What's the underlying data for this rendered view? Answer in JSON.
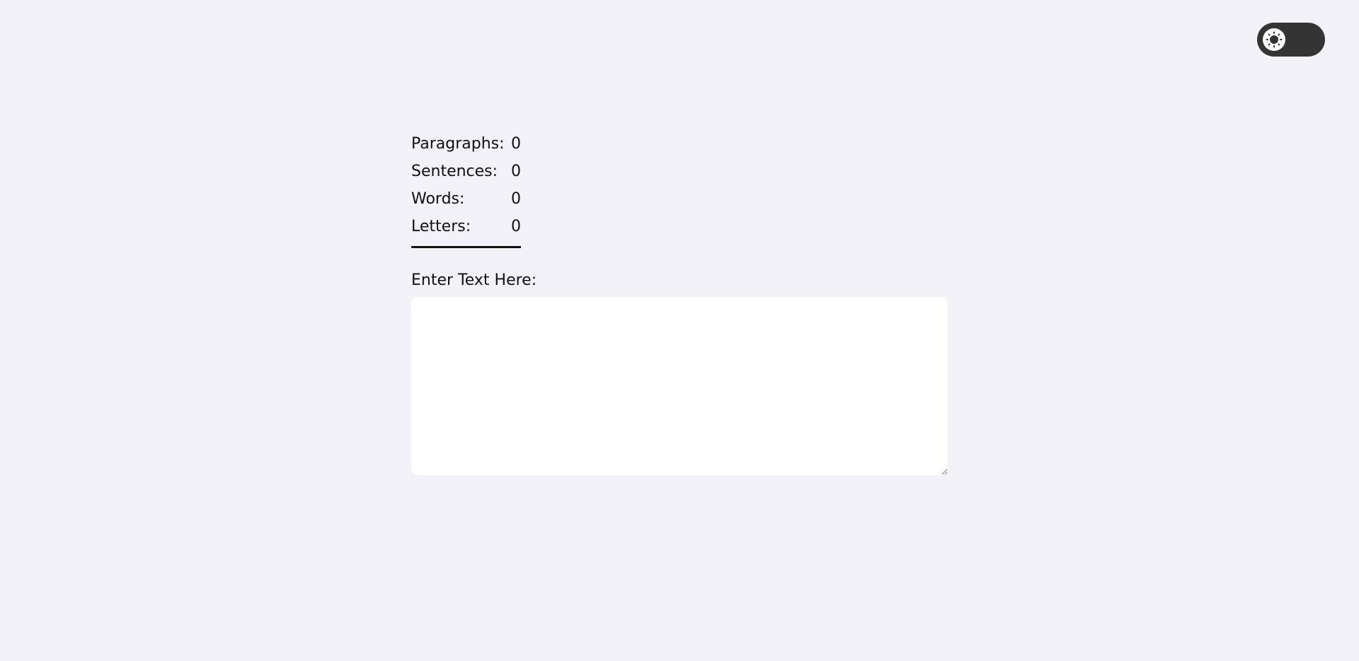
{
  "theme_toggle": {
    "icon": "sun-icon",
    "track_color": "#343434",
    "knob_color": "#ffffff"
  },
  "stats": [
    {
      "label": "Paragraphs:",
      "value": "0"
    },
    {
      "label": "Sentences:",
      "value": "0"
    },
    {
      "label": "Words:",
      "value": "0"
    },
    {
      "label": "Letters:",
      "value": "0"
    }
  ],
  "input": {
    "label": "Enter Text Here:",
    "value": "",
    "placeholder": ""
  },
  "colors": {
    "background": "#f2f2f8",
    "text": "#111111",
    "textarea_bg": "#ffffff"
  }
}
